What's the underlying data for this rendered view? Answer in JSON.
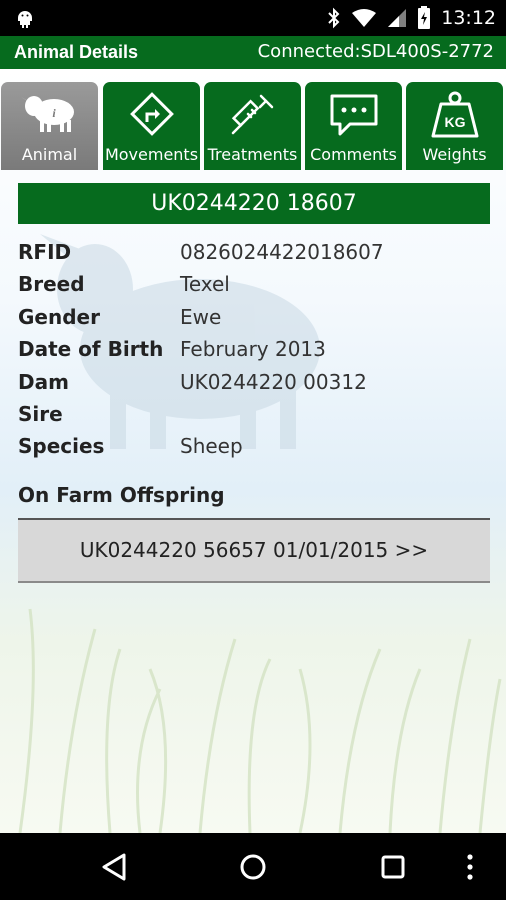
{
  "status_bar": {
    "time": "13:12"
  },
  "header": {
    "title": "Animal Details",
    "connection": "Connected:SDL400S-2772"
  },
  "tabs": [
    {
      "label": "Animal",
      "icon": "sheep-icon",
      "active": true
    },
    {
      "label": "Movements",
      "icon": "direction-sign-icon",
      "active": false
    },
    {
      "label": "Treatments",
      "icon": "syringe-icon",
      "active": false
    },
    {
      "label": "Comments",
      "icon": "comment-bubble-icon",
      "active": false
    },
    {
      "label": "Weights",
      "icon": "weight-kg-icon",
      "active": false
    }
  ],
  "weight_icon_text": "KG",
  "animal": {
    "id": "UK0244220 18607",
    "fields": [
      {
        "label": "RFID",
        "value": "0826024422018607"
      },
      {
        "label": "Breed",
        "value": "Texel"
      },
      {
        "label": "Gender",
        "value": "Ewe"
      },
      {
        "label": "Date of Birth",
        "value": "February 2013"
      },
      {
        "label": "Dam",
        "value": "UK0244220 00312"
      },
      {
        "label": "Sire",
        "value": ""
      },
      {
        "label": "Species",
        "value": "Sheep"
      }
    ]
  },
  "offspring": {
    "title": "On Farm Offspring",
    "items": [
      "UK0244220 56657 01/01/2015 >>"
    ]
  },
  "colors": {
    "brand_green": "#066b1e",
    "active_tab": "#8a8a8a"
  }
}
